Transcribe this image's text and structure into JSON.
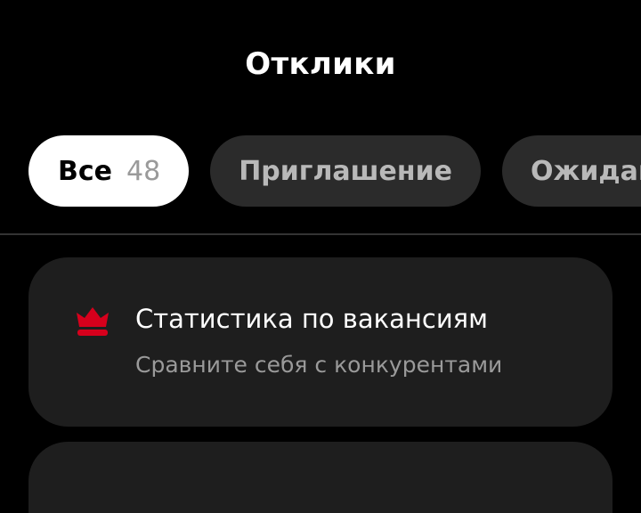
{
  "header": {
    "title": "Отклики"
  },
  "tabs": [
    {
      "label": "Все",
      "count": "48",
      "active": true
    },
    {
      "label": "Приглашение",
      "active": false
    },
    {
      "label": "Ожидание",
      "active": false
    }
  ],
  "promo_card": {
    "icon": "crown-icon",
    "title": "Статистика по вакансиям",
    "subtitle": "Сравните себя с конкурентами",
    "icon_color": "#d6001c"
  },
  "colors": {
    "background": "#000000",
    "card": "#1e1e1e",
    "tab_inactive": "#2b2b2b",
    "accent": "#d6001c"
  }
}
